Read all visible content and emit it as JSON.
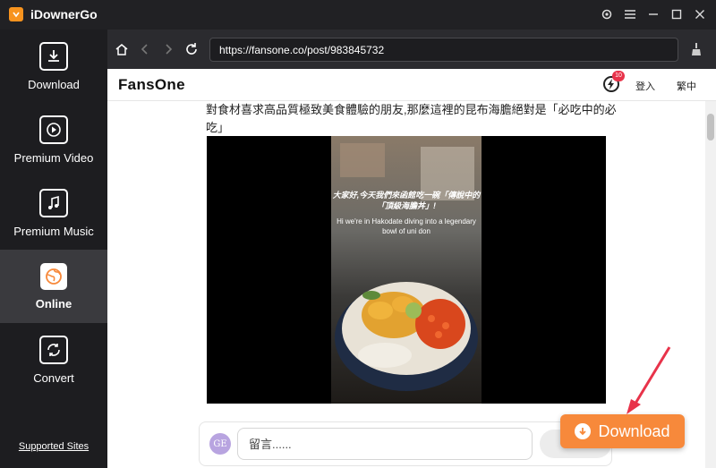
{
  "app": {
    "title": "iDownerGo"
  },
  "sidebar": {
    "items": [
      {
        "label": "Download",
        "icon": "download-icon"
      },
      {
        "label": "Premium Video",
        "icon": "play-icon"
      },
      {
        "label": "Premium Music",
        "icon": "music-icon"
      },
      {
        "label": "Online",
        "icon": "globe-icon",
        "active": true
      },
      {
        "label": "Convert",
        "icon": "convert-icon"
      }
    ],
    "supported_sites": "Supported Sites"
  },
  "browser": {
    "url": "https://fansone.co/post/983845732"
  },
  "site": {
    "logo": "FansOne",
    "badge_count": "10",
    "login": "登入",
    "language": "繁中"
  },
  "post": {
    "text": "對食材喜求高品質極致美食體驗的朋友,那麼這裡的昆布海膽絕對是「必吃中的必吃」",
    "subtitle_cn": "大家好,今天我們來函館吃一碗「傳說中的「頂級海膽丼」!",
    "subtitle_en": "Hi we're in Hakodate diving into a legendary bowl of uni don"
  },
  "comment": {
    "avatar": "GE",
    "placeholder": "留言......"
  },
  "download_button": {
    "label": "Download"
  },
  "colors": {
    "accent": "#f7893b",
    "sidebar_bg": "#1d1d20",
    "arrow": "#e8334a"
  }
}
